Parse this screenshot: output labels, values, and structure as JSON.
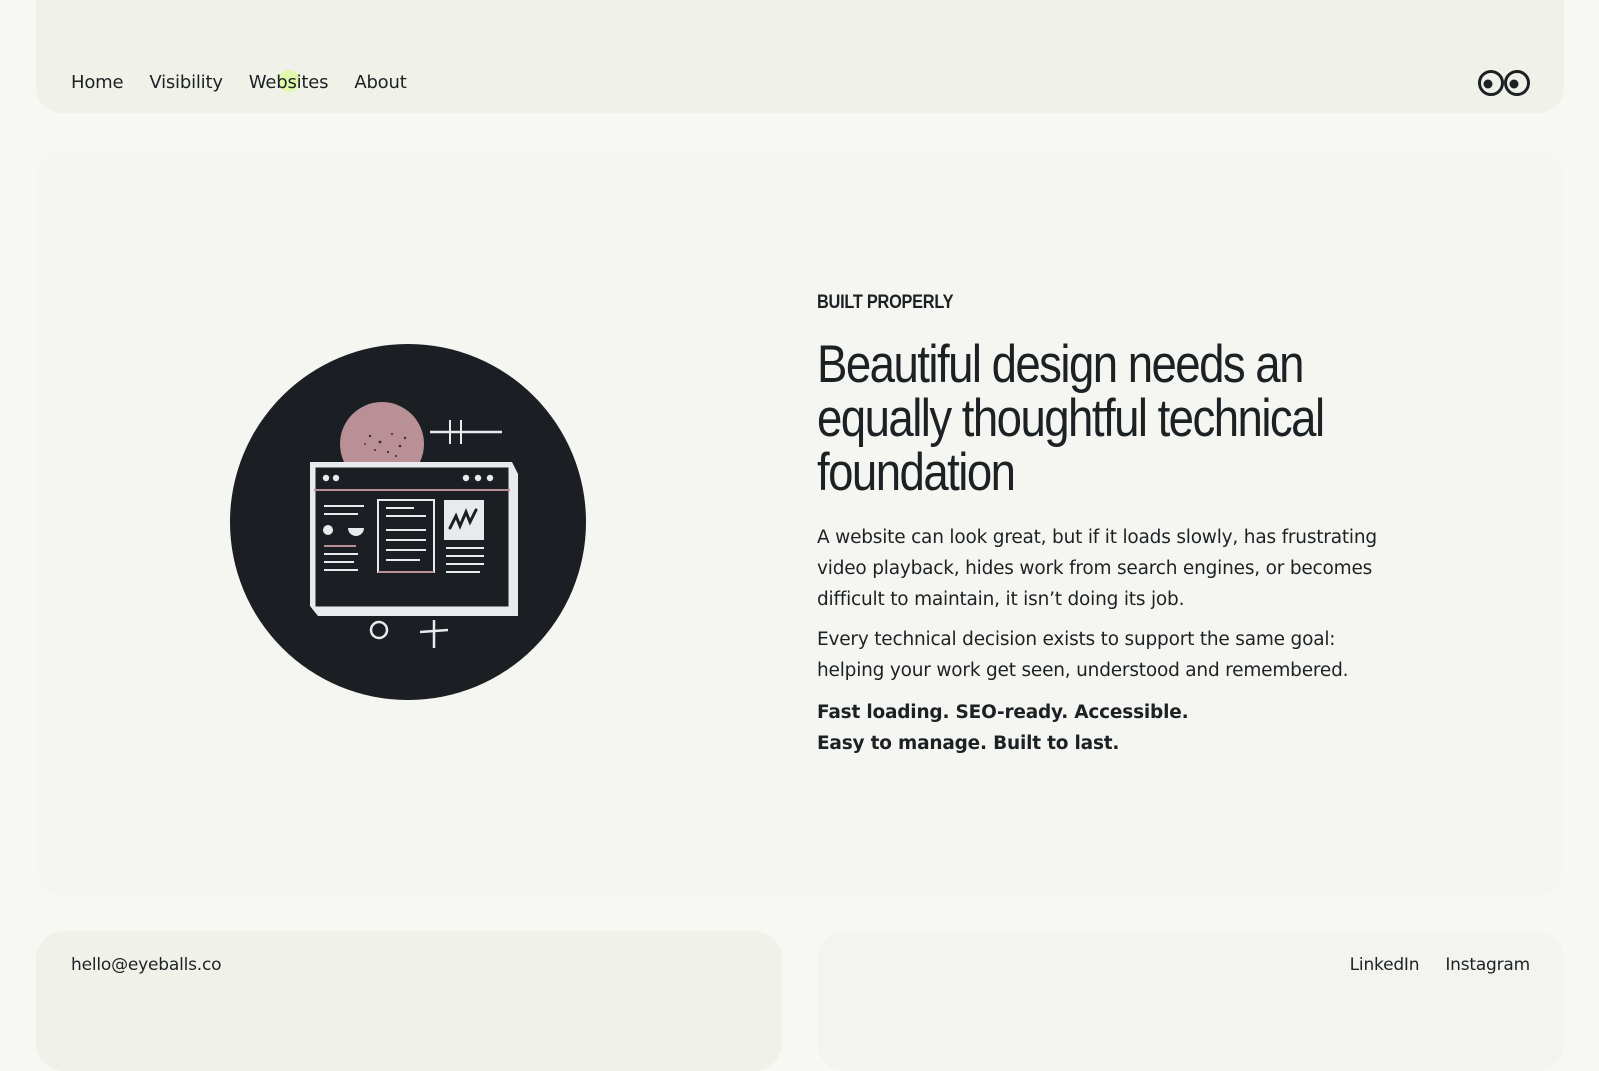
{
  "nav": {
    "items": [
      {
        "label": "Home"
      },
      {
        "label": "Visibility"
      },
      {
        "label": "Websites"
      },
      {
        "label": "About"
      }
    ]
  },
  "logo": {
    "icon": "eyeballs-logo-icon"
  },
  "hero": {
    "illustration": {
      "icon": "website-browser-illustration-icon"
    },
    "eyebrow": "BUILT PROPERLY",
    "headline": "Beautiful design needs an equally thoughtful technical foundation",
    "paragraph1": "A website can look great, but if it loads slowly, has frustrating video playback, hides work from search engines, or becomes difficult to maintain, it isn’t doing its job.",
    "paragraph2": "Every technical decision exists to support the same goal: helping your work get seen, understood and remembered.",
    "tagline_line1": "Fast loading. SEO-ready. Accessible.",
    "tagline_line2": "Easy to manage. Built to last."
  },
  "footer": {
    "email": "hello@eyeballs.co",
    "socials": [
      {
        "label": "LinkedIn"
      },
      {
        "label": "Instagram"
      }
    ]
  },
  "colors": {
    "background": "#f7f8f4",
    "panel": "#f0f1e8",
    "text": "#1c2124",
    "illustration_dark": "#1b1e22",
    "illustration_pink": "#b89095",
    "cursor_highlight": "#d6ff78"
  }
}
